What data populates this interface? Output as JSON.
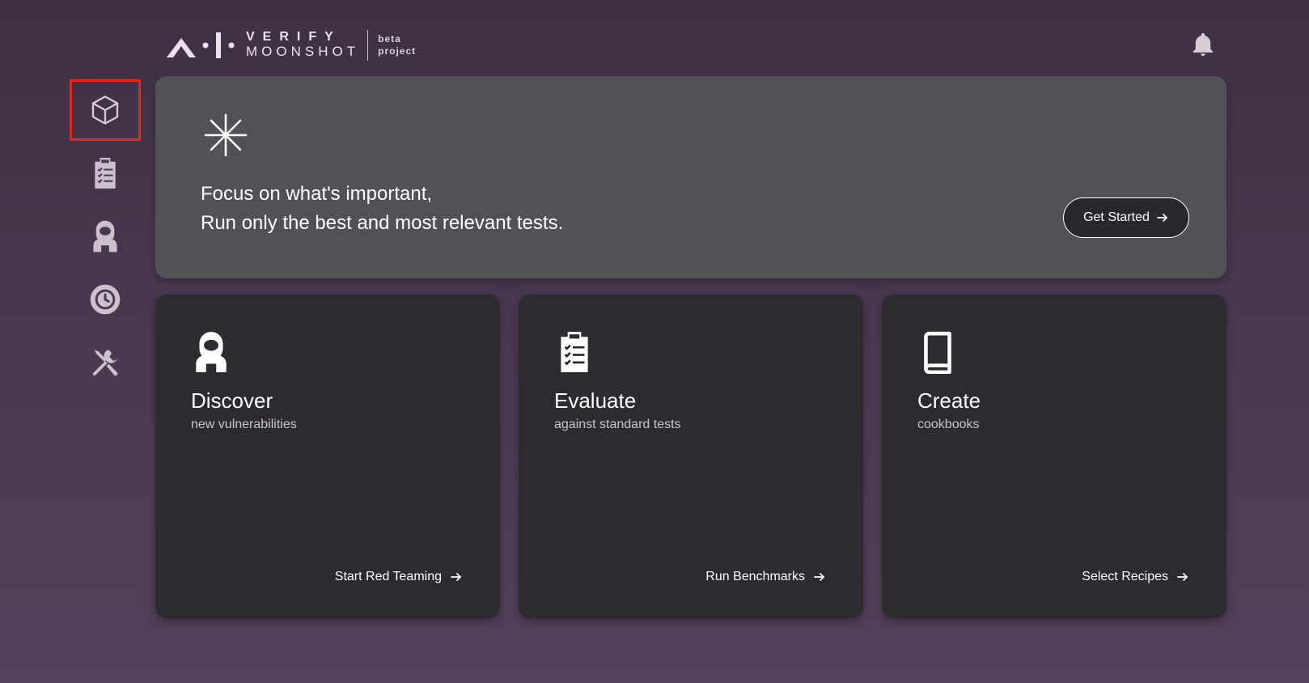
{
  "header": {
    "logo_verify": "VERIFY",
    "logo_moonshot": "MOONSHOT",
    "logo_beta": "beta",
    "logo_project": "project",
    "notification_icon": "bell-icon"
  },
  "sidebar": {
    "items": [
      {
        "icon": "cube-icon",
        "active": true
      },
      {
        "icon": "clipboard-icon"
      },
      {
        "icon": "astronaut-icon"
      },
      {
        "icon": "history-icon"
      },
      {
        "icon": "tools-icon"
      }
    ]
  },
  "banner": {
    "line1": "Focus on what's important,",
    "line2": "Run only the best and most relevant tests.",
    "button_label": "Get Started"
  },
  "cards": [
    {
      "title": "Discover",
      "subtitle": "new vulnerabilities",
      "action": "Start Red Teaming",
      "icon": "astronaut-icon"
    },
    {
      "title": "Evaluate",
      "subtitle": "against standard tests",
      "action": "Run Benchmarks",
      "icon": "clipboard-icon"
    },
    {
      "title": "Create",
      "subtitle": "cookbooks",
      "action": "Select Recipes",
      "icon": "book-icon"
    }
  ],
  "colors": {
    "active_outline": "#e0281b",
    "banner_bg": "#535057",
    "card_bg": "#2d2a30"
  }
}
